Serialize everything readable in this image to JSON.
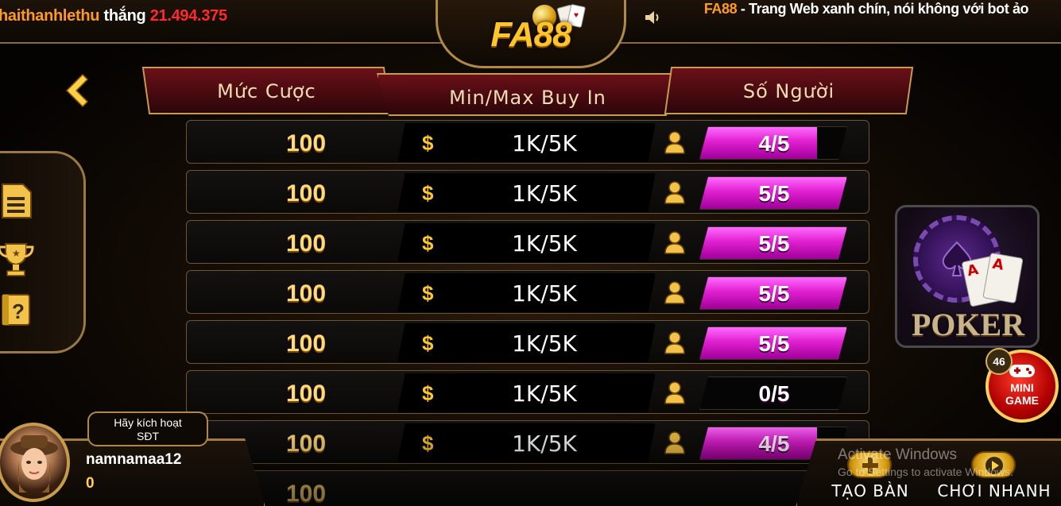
{
  "topbar": {
    "winner_user": "haithanhlethu",
    "winner_word": "thắng",
    "winner_amount": "21.494.375",
    "announcement_brand": "FA88",
    "announcement_text": " - Trang Web xanh chín, nói không với bot ảo",
    "logo_text": "FA88"
  },
  "table_header": {
    "col_bet": "Mức Cược",
    "col_buyin": "Min/Max Buy In",
    "col_players": "Số Người"
  },
  "rooms": [
    {
      "bet": "100",
      "buyin": "1K/5K",
      "players": "4/5",
      "occupancy": 0.8
    },
    {
      "bet": "100",
      "buyin": "1K/5K",
      "players": "5/5",
      "occupancy": 1.0
    },
    {
      "bet": "100",
      "buyin": "1K/5K",
      "players": "5/5",
      "occupancy": 1.0
    },
    {
      "bet": "100",
      "buyin": "1K/5K",
      "players": "5/5",
      "occupancy": 1.0
    },
    {
      "bet": "100",
      "buyin": "1K/5K",
      "players": "5/5",
      "occupancy": 1.0
    },
    {
      "bet": "100",
      "buyin": "1K/5K",
      "players": "0/5",
      "occupancy": 0.0
    },
    {
      "bet": "100",
      "buyin": "1K/5K",
      "players": "4/5",
      "occupancy": 0.8
    },
    {
      "bet": "100",
      "buyin": "",
      "players": "",
      "occupancy": 0.0
    }
  ],
  "currency_symbol": "$",
  "side_panel": {
    "icons": [
      "document-icon",
      "trophy-icon",
      "help-icon"
    ]
  },
  "game_promo": {
    "label": "POKER",
    "card_rank": "A"
  },
  "mini_game": {
    "label_line1": "MINI",
    "label_line2": "GAME",
    "badge_count": "46"
  },
  "user": {
    "activate_line1": "Hãy kích hoạt",
    "activate_line2": "SĐT",
    "name": "namnamaa12",
    "balance": "0"
  },
  "actions": {
    "create_table": "TẠO BÀN",
    "quick_play": "CHƠI NHANH"
  },
  "os_watermark": {
    "line1": "Activate Windows",
    "line2": "Go to Settings to activate Windows."
  },
  "colors": {
    "accent_gold": "#ffd97a",
    "seat_fill": "#e020d0",
    "header_red": "#6a1018",
    "winner_user": "#ff9a1e",
    "winner_amount": "#ff2a2a"
  }
}
